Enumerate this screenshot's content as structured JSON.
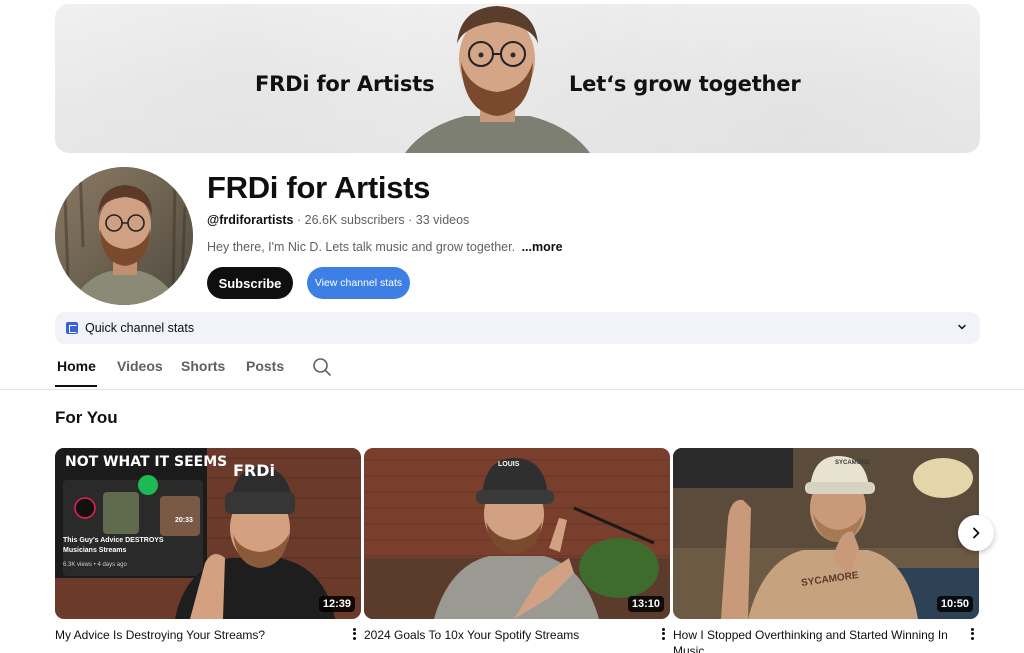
{
  "banner": {
    "left_text": "FRDi for Artists",
    "right_text": "Let‘s grow together"
  },
  "channel": {
    "name": "FRDi for Artists",
    "handle": "@frdiforartists",
    "subscribers": "26.6K subscribers",
    "videos": "33 videos",
    "separator": " · ",
    "description": "Hey there, I'm Nic D. Lets talk music and grow together.",
    "more_label": "...more"
  },
  "buttons": {
    "subscribe": "Subscribe",
    "view_stats": "View channel stats"
  },
  "quick_stats": {
    "label": "Quick channel stats",
    "icon": "chart-icon"
  },
  "tabs": [
    {
      "label": "Home",
      "active": true
    },
    {
      "label": "Videos",
      "active": false
    },
    {
      "label": "Shorts",
      "active": false
    },
    {
      "label": "Posts",
      "active": false
    }
  ],
  "section": {
    "title": "For You"
  },
  "videos": [
    {
      "title": "My Advice Is Destroying Your Streams?",
      "duration": "12:39",
      "thumb_overlay": {
        "headline": "NOT WHAT IT SEEMS",
        "cap_text": "FRDi",
        "inner_title": "This Guy's Advice DESTROYS Musicians Streams",
        "inner_meta": "6.3K views • 4 days ago",
        "inner_duration": "20:33"
      }
    },
    {
      "title": "2024 Goals To 10x Your Spotify Streams",
      "duration": "13:10",
      "thumb_overlay": {
        "cap_text": "LOUIS"
      }
    },
    {
      "title": "How I Stopped Overthinking and Started Winning In Music",
      "duration": "10:50",
      "thumb_overlay": {
        "cap_text": "SYCAMORE",
        "shirt_text": "SYCAMORE"
      }
    }
  ],
  "colors": {
    "subscribe_bg": "#0f0f0f",
    "stats_button_bg": "#3e7fe6",
    "quick_stats_bg": "#f1f3f8",
    "text_primary": "#0f0f0f",
    "text_secondary": "#606060"
  }
}
